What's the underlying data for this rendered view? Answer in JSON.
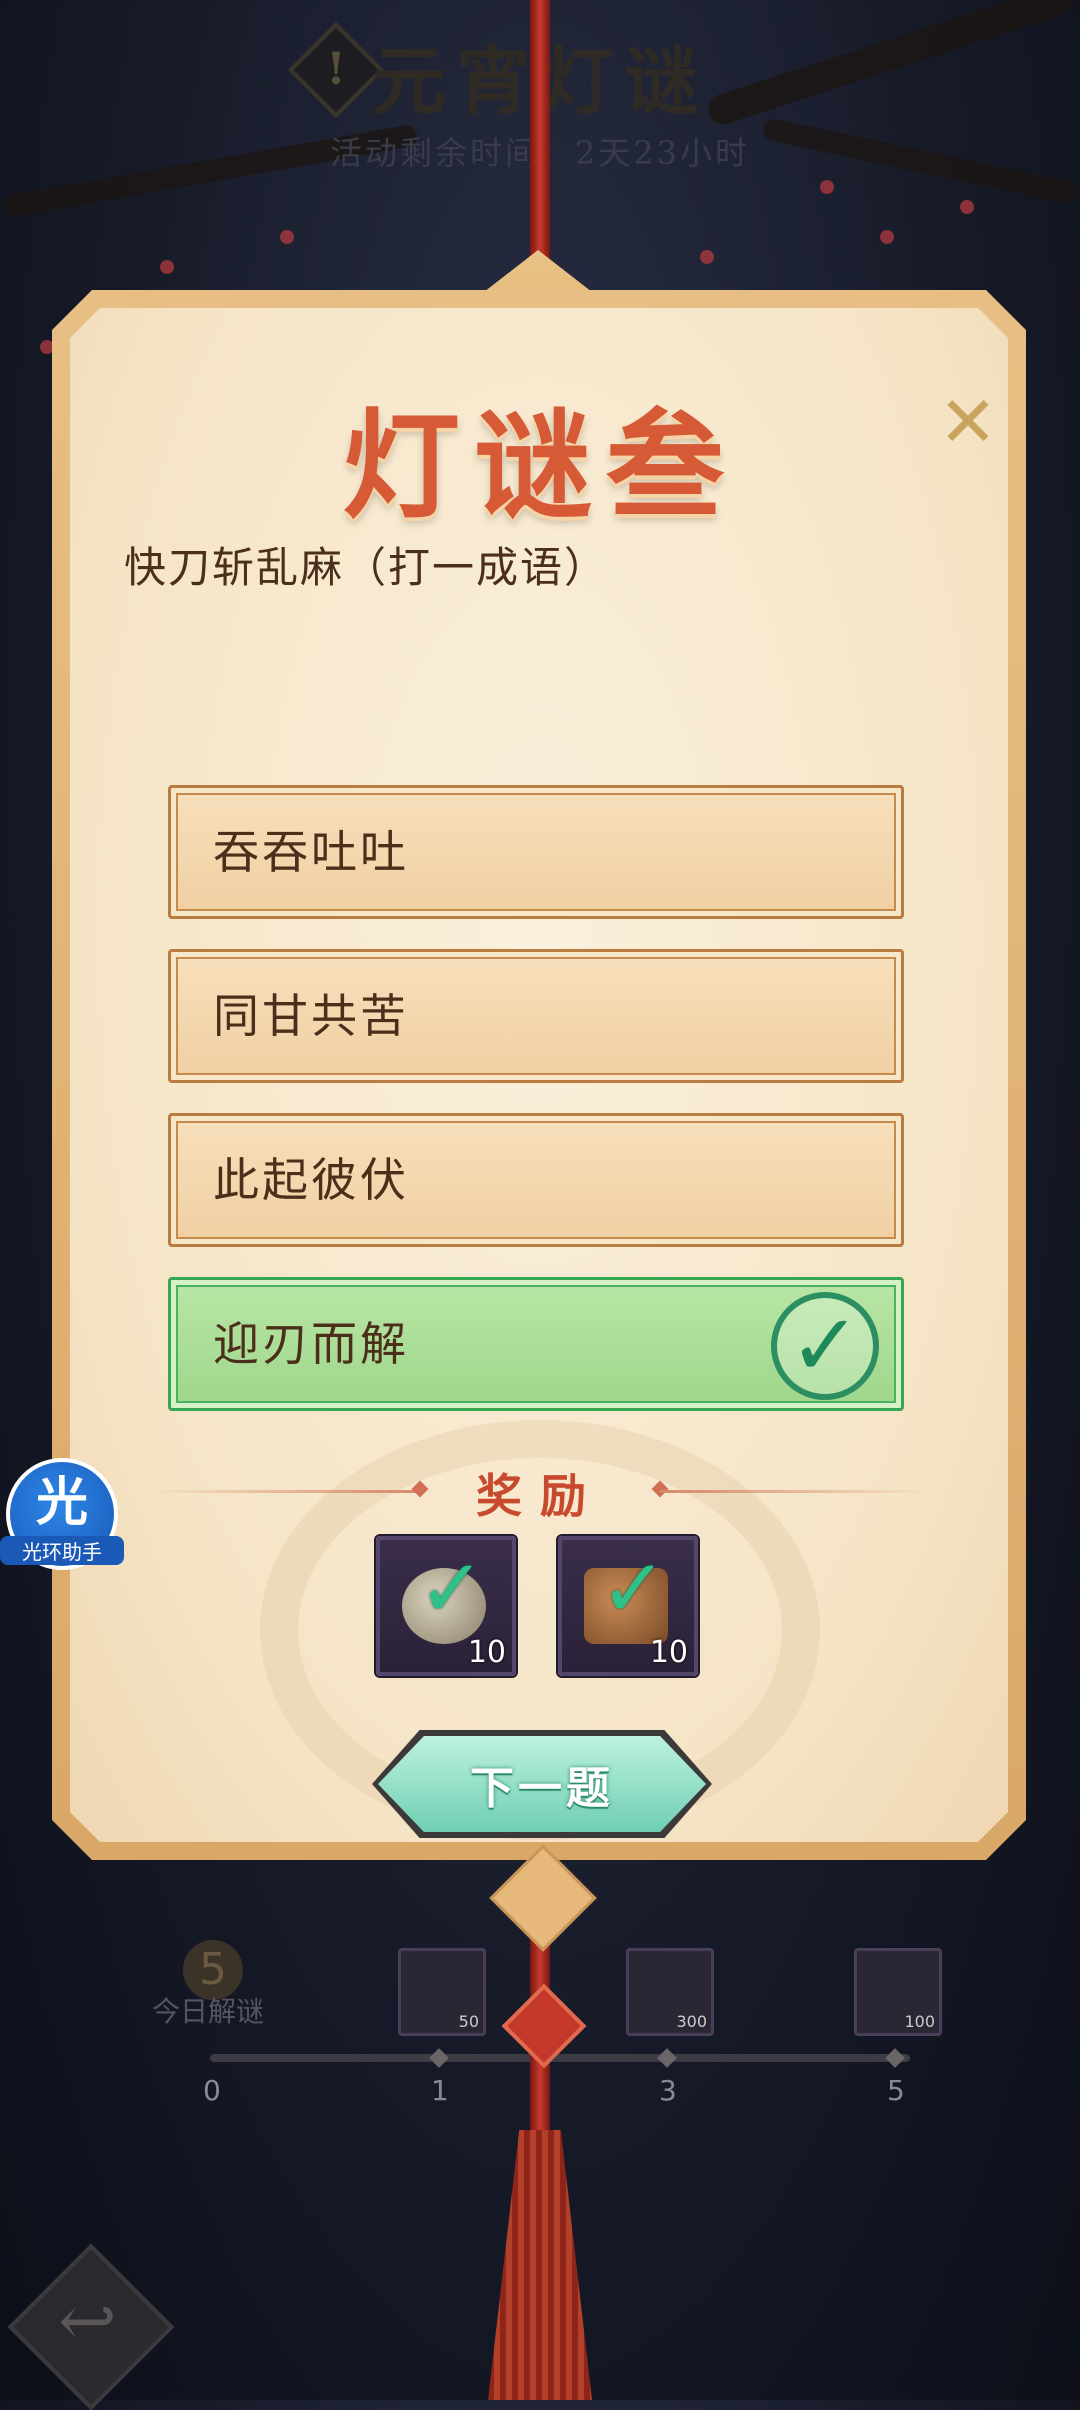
{
  "header": {
    "title": "元宵灯谜",
    "remaining_time": "活动剩余时间：2天23小时",
    "icon_glyph": "!"
  },
  "card": {
    "title": "灯谜叁",
    "close_glyph": "✕",
    "riddle": "快刀斩乱麻（打一成语）",
    "options": [
      {
        "label": "吞吞吐吐",
        "correct": false
      },
      {
        "label": "同甘共苦",
        "correct": false
      },
      {
        "label": "此起彼伏",
        "correct": false
      },
      {
        "label": "迎刃而解",
        "correct": true
      }
    ],
    "check_glyph": "✓",
    "reward_title": "奖励",
    "rewards": [
      {
        "icon": "jade-bi-icon",
        "count": "10"
      },
      {
        "icon": "seal-icon",
        "count": "10"
      }
    ],
    "next_button": "下一题"
  },
  "progress": {
    "today_count": "5",
    "today_label": "今日解谜",
    "ticks": [
      "0",
      "1",
      "3",
      "5"
    ],
    "milestones": [
      {
        "icon": "jade-bi-icon",
        "count": "50"
      },
      {
        "icon": "gold-ingot-icon",
        "count": "300"
      },
      {
        "icon": "jade-bi-icon",
        "count": "100"
      }
    ]
  },
  "helper": {
    "char": "光",
    "label": "光环助手"
  },
  "colors": {
    "accent_red": "#d55a35",
    "correct_green": "#36a651",
    "next_button": "#6fcfb3"
  }
}
